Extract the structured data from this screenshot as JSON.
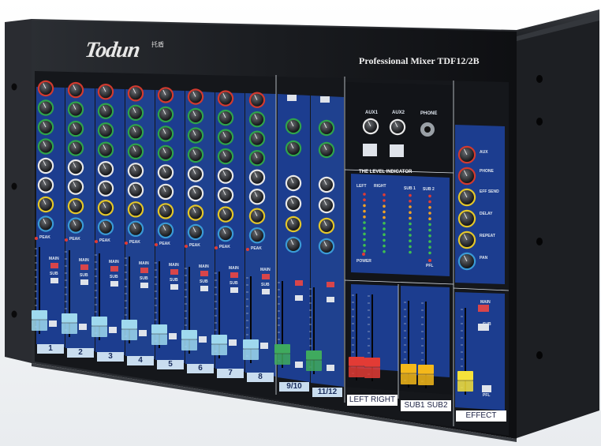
{
  "header": {
    "brand": "Todun",
    "brand_chinese": "托盾",
    "model": "Professional Mixer  TDF12/2B"
  },
  "channel_strip": {
    "knob_labels": [
      "GAIN",
      "HIGH",
      "MID",
      "LOW",
      "AUX1",
      "AUX2",
      "EFF",
      "PAN"
    ],
    "peak_label": "PEAK",
    "main_label": "MAIN",
    "sub_label": "SUB",
    "pfl_label": "PFL",
    "input_label": "INPUT",
    "input_pad": "-10"
  },
  "channels": [
    "1",
    "2",
    "3",
    "4",
    "5",
    "6",
    "7",
    "8",
    "9/10",
    "11/12"
  ],
  "aux_section": {
    "aux1": "AUX1",
    "aux2": "AUX2",
    "phone": "PHONE"
  },
  "level_indicator": {
    "title": "THE LEVEL INDICATOR",
    "left": "LEFT",
    "right": "RIGHT",
    "sub1": "SUB 1",
    "sub2": "SUB 2",
    "power": "POWER",
    "pfl": "PFL",
    "scale": [
      "+10",
      "+7",
      "+4",
      "+2",
      "0",
      "-2",
      "-4",
      "-7",
      "-10",
      "-15",
      "-20"
    ]
  },
  "effect_section": {
    "knobs": [
      "AUX",
      "PHONE",
      "EFF SEND",
      "DELAY",
      "REPEAT",
      "PAN"
    ],
    "main": "MAIN",
    "sub": "SUB",
    "pfl": "PFL"
  },
  "master_labels": {
    "left_right": "LEFT  RIGHT",
    "sub1_sub2": "SUB1  SUB2",
    "effect": "EFFECT"
  },
  "colors": {
    "chassis": "#1b1d21",
    "panel_blue": "#1c3d8f",
    "panel_dark": "#15171b",
    "fader_mono": "#9fd9ee",
    "fader_stereo": "#3faa5e",
    "fader_main": "#e23b35",
    "fader_sub": "#f4b81a",
    "fader_effect": "#f6e23a"
  }
}
